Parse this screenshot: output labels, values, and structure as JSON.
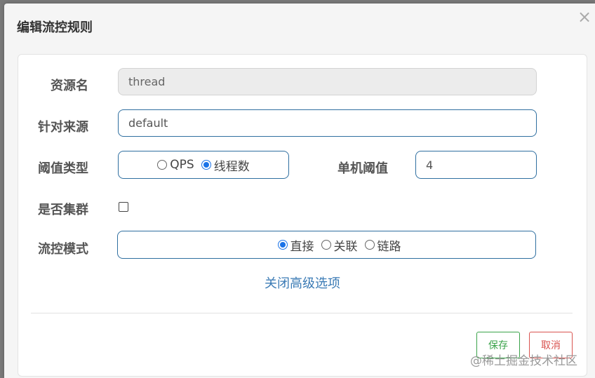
{
  "dialog": {
    "title": "编辑流控规则",
    "close_glyph": "×"
  },
  "form": {
    "resource_name": {
      "label": "资源名",
      "value": "thread"
    },
    "limit_app": {
      "label": "针对来源",
      "value": "default"
    },
    "grade": {
      "label": "阈值类型",
      "options": [
        {
          "label": "QPS",
          "selected": false
        },
        {
          "label": "线程数",
          "selected": true
        }
      ]
    },
    "count": {
      "label": "单机阈值",
      "value": "4"
    },
    "cluster": {
      "label": "是否集群",
      "checked": false
    },
    "strategy": {
      "label": "流控模式",
      "options": [
        {
          "label": "直接",
          "selected": true
        },
        {
          "label": "关联",
          "selected": false
        },
        {
          "label": "链路",
          "selected": false
        }
      ]
    },
    "advanced_toggle": "关闭高级选项"
  },
  "footer": {
    "save_label": "保存",
    "cancel_label": "取消"
  },
  "watermark": "@稀土掘金技术社区",
  "colors": {
    "accent": "#1a73e8",
    "input_border": "#2f6fa0",
    "link": "#3b7bb5",
    "save": "#3aa34a",
    "cancel": "#d9534f"
  }
}
